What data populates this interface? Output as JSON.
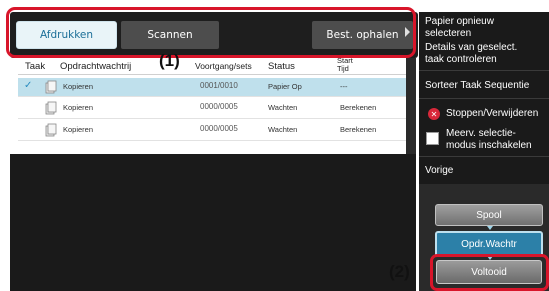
{
  "tabs": {
    "print": "Afdrukken",
    "scan": "Scannen",
    "fetch": "Best. ophalen"
  },
  "annotations": {
    "label1": "(1)",
    "label2": "(2)"
  },
  "columns": {
    "job": "Taak",
    "queue": "Opdrachtwachtrij",
    "progress": "Voortgang/sets",
    "status": "Status",
    "start_line1": "Start",
    "start_line2": "Tijd"
  },
  "rows": [
    {
      "name": "Kopieren",
      "progress": "0001/0010",
      "status": "Papier Op",
      "start": "---",
      "selected": true
    },
    {
      "name": "Kopieren",
      "progress": "0000/0005",
      "status": "Wachten",
      "start": "Berekenen",
      "selected": false
    },
    {
      "name": "Kopieren",
      "progress": "0000/0005",
      "status": "Wachten",
      "start": "Berekenen",
      "selected": false
    }
  ],
  "menu": {
    "item1_line1": "Papier opnieuw",
    "item1_line2": "selecteren",
    "item2_line1": "Details van geselect.",
    "item2_line2": "taak controleren",
    "item3": "Sorteer Taak Sequentie",
    "item4": "Stoppen/Verwijderen",
    "item5_line1": "Meerv. selectie-",
    "item5_line2": "modus inschakelen",
    "item6": "Vorige"
  },
  "buttons": {
    "spool": "Spool",
    "queue": "Opdr.Wachtr",
    "done": "Voltooid"
  },
  "colors": {
    "accent_red": "#d8152a",
    "selected_row": "#bfe0ec",
    "active_tab_text": "#1c6f98",
    "queue_button": "#2c80a8"
  }
}
